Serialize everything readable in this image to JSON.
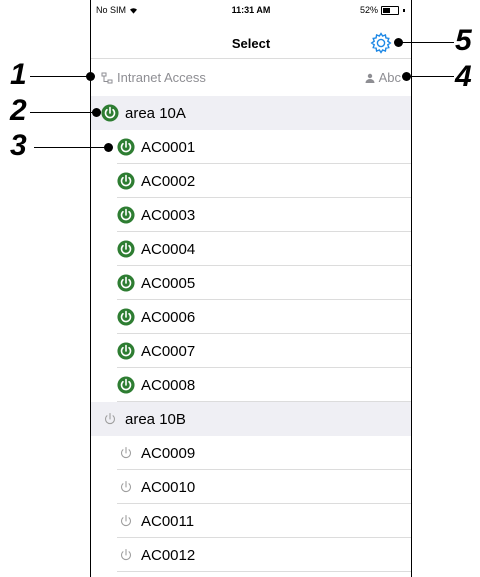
{
  "status_bar": {
    "carrier": "No SIM",
    "time": "11:31 AM",
    "battery": "52%",
    "battery_level": 0.52
  },
  "nav": {
    "title": "Select"
  },
  "info_bar": {
    "network_label": "Intranet Access",
    "user_label": "Abc"
  },
  "callouts": [
    "1",
    "2",
    "3",
    "4",
    "5"
  ],
  "groups": [
    {
      "name": "area 10A",
      "power": "on",
      "units": [
        "AC0001",
        "AC0002",
        "AC0003",
        "AC0004",
        "AC0005",
        "AC0006",
        "AC0007",
        "AC0008"
      ]
    },
    {
      "name": "area 10B",
      "power": "off",
      "units": [
        "AC0009",
        "AC0010",
        "AC0011",
        "AC0012"
      ]
    }
  ],
  "colors": {
    "power_on": "#2e7d32",
    "power_off": "#9e9e9e",
    "accent": "#1e88e5",
    "group_bg": "#efeff4"
  }
}
